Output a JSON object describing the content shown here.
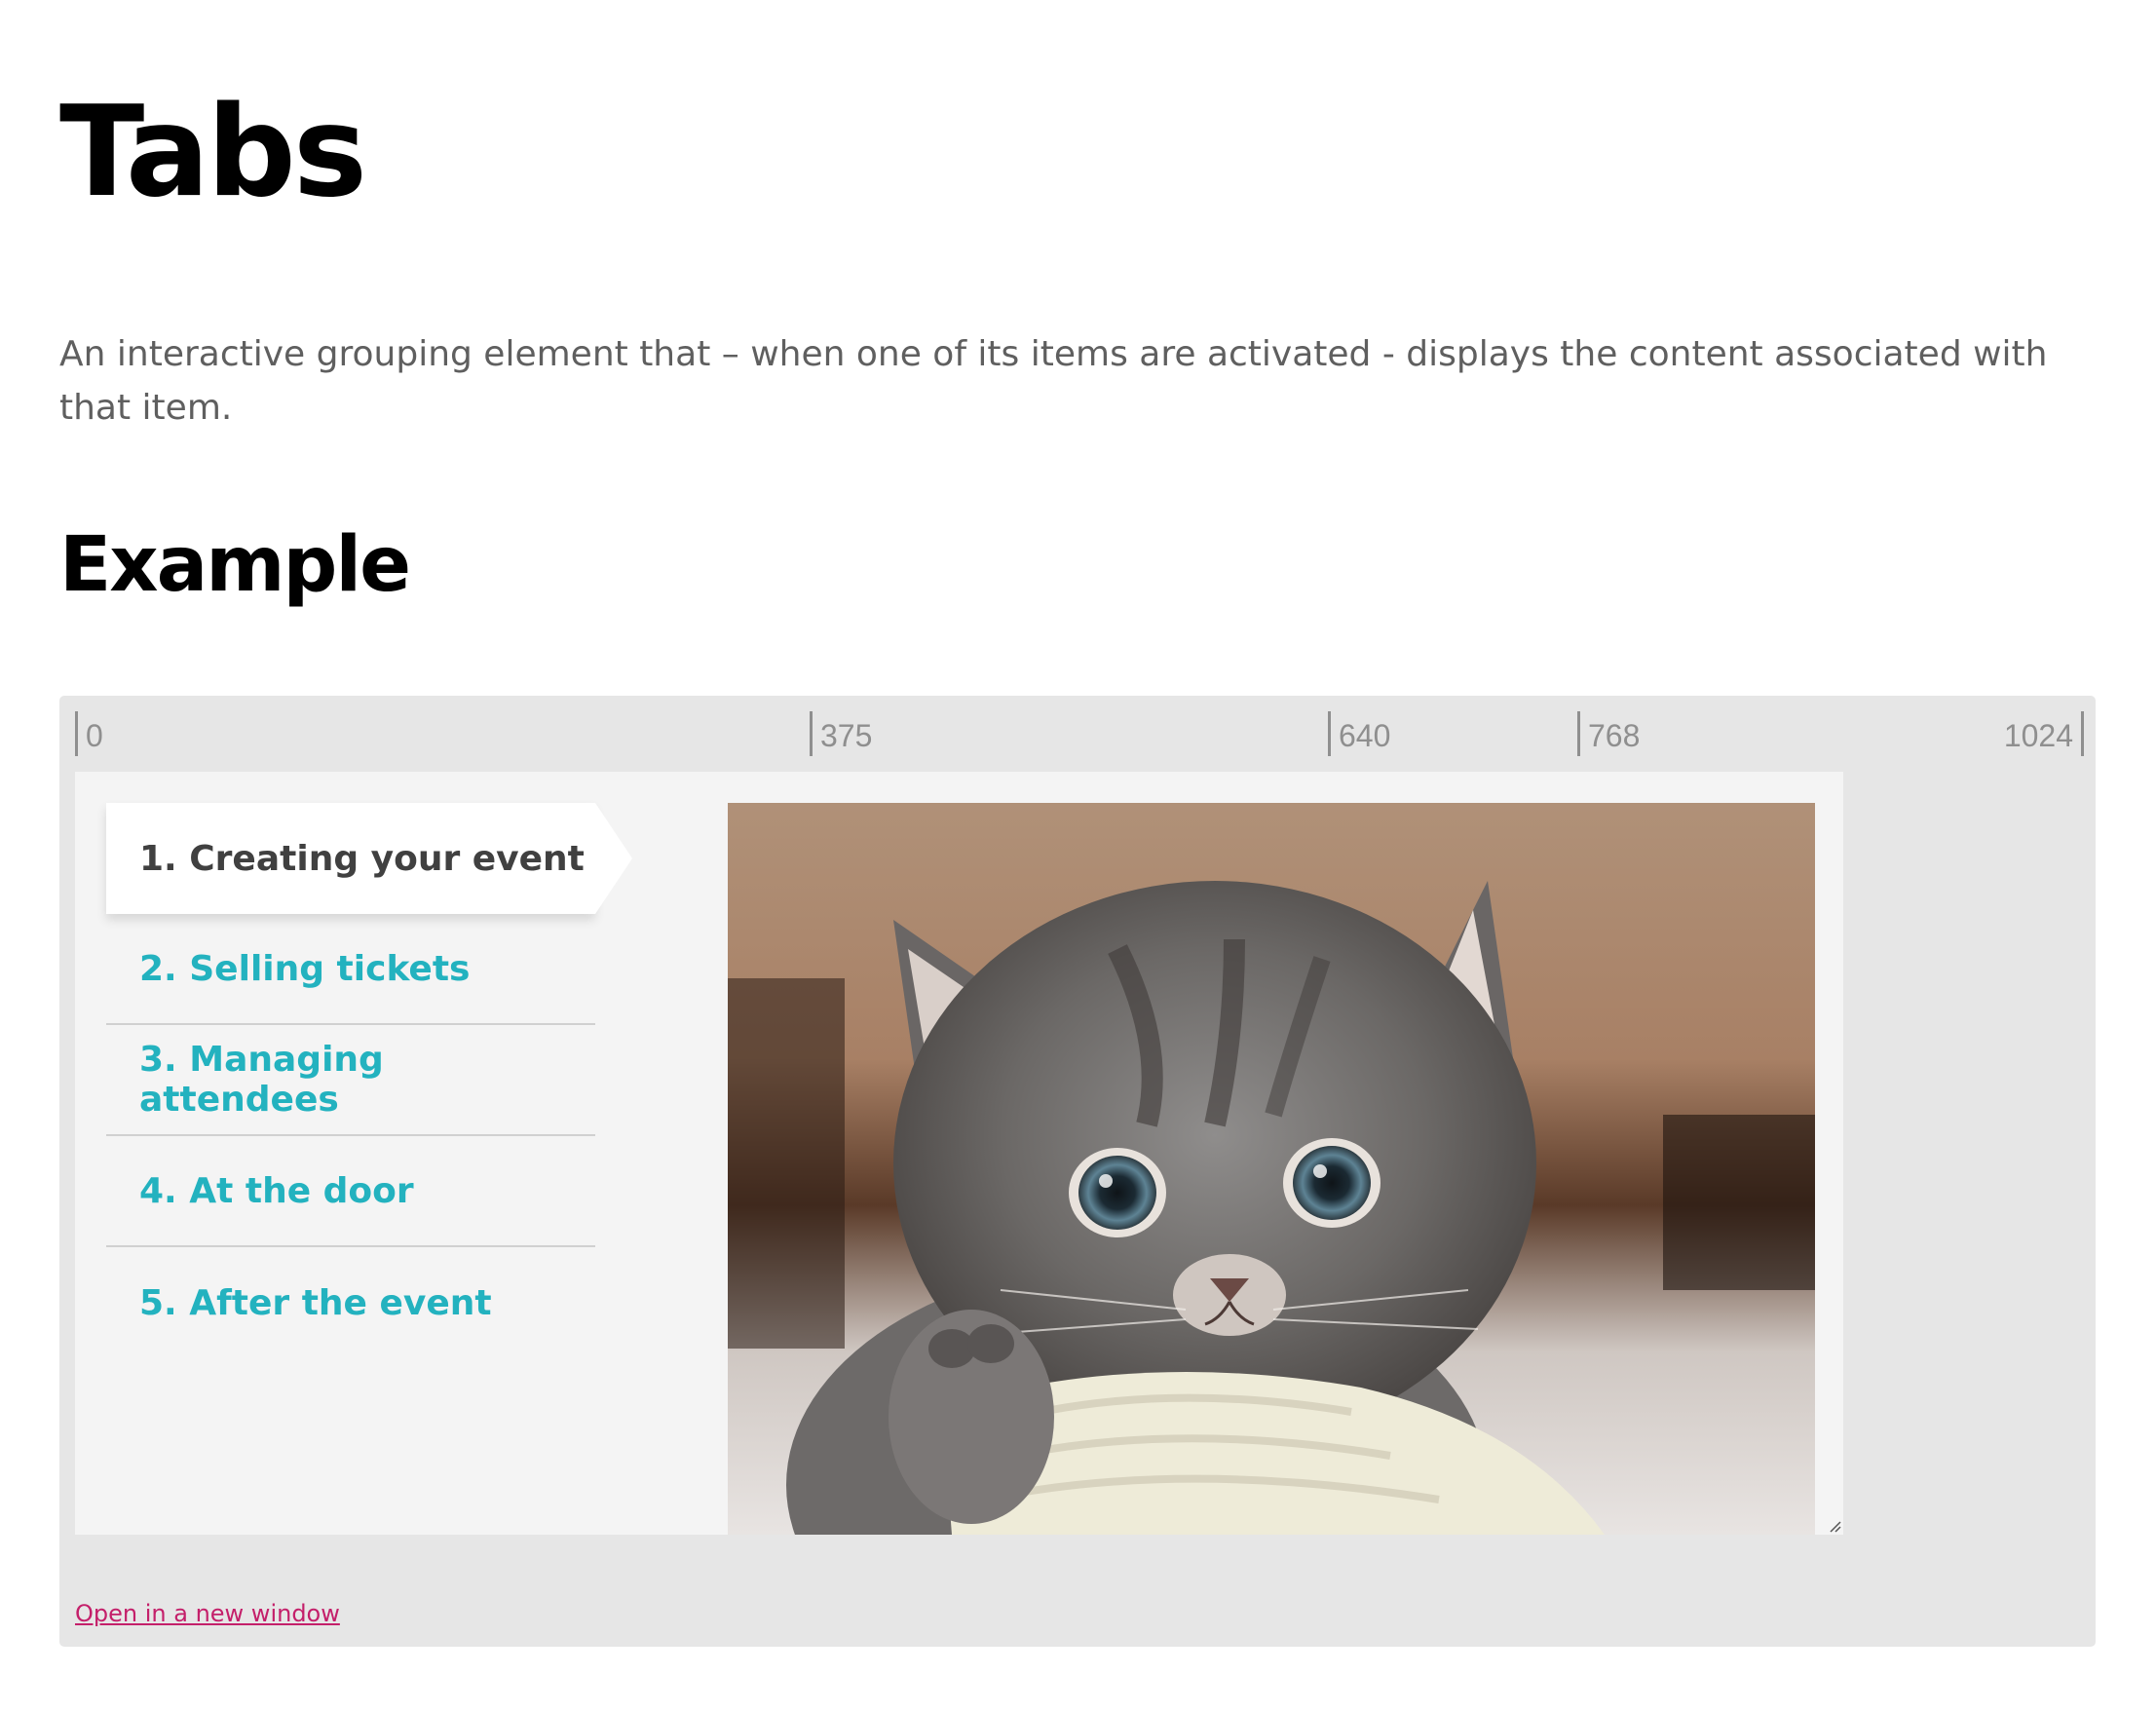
{
  "page": {
    "title": "Tabs",
    "description": "An interactive grouping element that – when one of its items are activated - displays the content associated with that item.",
    "section_heading": "Example"
  },
  "ruler": {
    "ticks": [
      "0",
      "375",
      "640",
      "768",
      "1024"
    ]
  },
  "tabs": [
    {
      "label": "1. Creating your event",
      "active": true
    },
    {
      "label": "2. Selling tickets",
      "active": false
    },
    {
      "label": "3. Managing attendees",
      "active": false
    },
    {
      "label": "4. At the door",
      "active": false
    },
    {
      "label": "5. After the event",
      "active": false
    }
  ],
  "panel": {
    "image_subject": "kitten-photo",
    "icon": "resize-grip-icon"
  },
  "footer": {
    "open_link": "Open in a new window"
  },
  "colors": {
    "accent": "#23b2bf",
    "active_tab_text": "#404040",
    "link": "#c41f6a",
    "frame_bg": "#e6e6e6",
    "viewport_bg": "#f4f4f4"
  }
}
